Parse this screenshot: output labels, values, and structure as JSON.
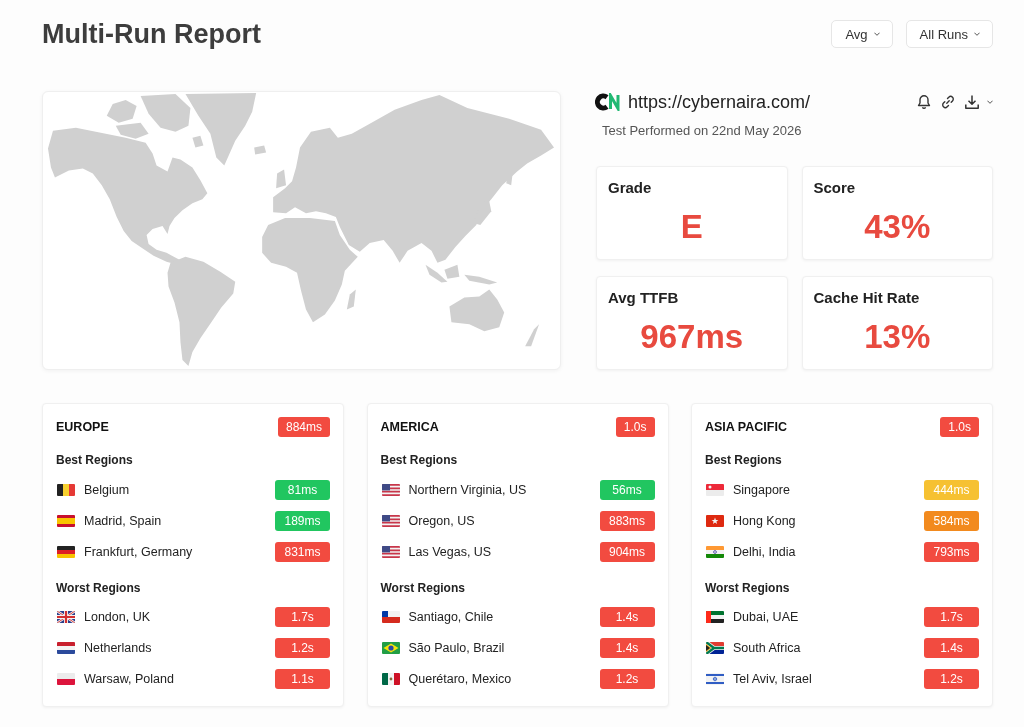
{
  "header": {
    "title": "Multi-Run Report",
    "filters": [
      {
        "label": "Avg"
      },
      {
        "label": "All Runs"
      }
    ]
  },
  "site": {
    "url": "https://cybernaira.com/",
    "tested": "Test Performed on 22nd May 2026"
  },
  "stats": [
    {
      "label": "Grade",
      "value": "E"
    },
    {
      "label": "Score",
      "value": "43%"
    },
    {
      "label": "Avg TTFB",
      "value": "967ms"
    },
    {
      "label": "Cache Hit Rate",
      "value": "13%"
    }
  ],
  "regions": [
    {
      "name": "EUROPE",
      "average": "884ms",
      "color": "#f24b40",
      "sections": [
        {
          "label": "Best Regions",
          "rows": [
            {
              "name": "Belgium",
              "time": "81ms",
              "color": "#21c660"
            },
            {
              "name": "Madrid, Spain",
              "time": "189ms",
              "color": "#21c660"
            },
            {
              "name": "Frankfurt, Germany",
              "time": "831ms",
              "color": "#f24b40"
            }
          ]
        },
        {
          "label": "Worst Regions",
          "rows": [
            {
              "name": "London, UK",
              "time": "1.7s",
              "color": "#f24b40"
            },
            {
              "name": "Netherlands",
              "time": "1.2s",
              "color": "#f24b40"
            },
            {
              "name": "Warsaw, Poland",
              "time": "1.1s",
              "color": "#f24b40"
            }
          ]
        }
      ]
    },
    {
      "name": "AMERICA",
      "average": "1.0s",
      "color": "#f24b40",
      "sections": [
        {
          "label": "Best Regions",
          "rows": [
            {
              "name": "Northern Virginia, US",
              "time": "56ms",
              "color": "#21c660"
            },
            {
              "name": "Oregon, US",
              "time": "883ms",
              "color": "#f24b40"
            },
            {
              "name": "Las Vegas, US",
              "time": "904ms",
              "color": "#f24b40"
            }
          ]
        },
        {
          "label": "Worst Regions",
          "rows": [
            {
              "name": "Santiago, Chile",
              "time": "1.4s",
              "color": "#f24b40"
            },
            {
              "name": "São Paulo, Brazil",
              "time": "1.4s",
              "color": "#f24b40"
            },
            {
              "name": "Querétaro, Mexico",
              "time": "1.2s",
              "color": "#f24b40"
            }
          ]
        }
      ]
    },
    {
      "name": "ASIA PACIFIC",
      "average": "1.0s",
      "color": "#f24b40",
      "sections": [
        {
          "label": "Best Regions",
          "rows": [
            {
              "name": "Singapore",
              "time": "444ms",
              "color": "#f6c132"
            },
            {
              "name": "Hong Kong",
              "time": "584ms",
              "color": "#f28a1e"
            },
            {
              "name": "Delhi, India",
              "time": "793ms",
              "color": "#f24b40"
            }
          ]
        },
        {
          "label": "Worst Regions",
          "rows": [
            {
              "name": "Dubai, UAE",
              "time": "1.7s",
              "color": "#f24b40"
            },
            {
              "name": "South Africa",
              "time": "1.4s",
              "color": "#f24b40"
            },
            {
              "name": "Tel Aviv, Israel",
              "time": "1.2s",
              "color": "#f24b40"
            }
          ]
        }
      ]
    }
  ]
}
